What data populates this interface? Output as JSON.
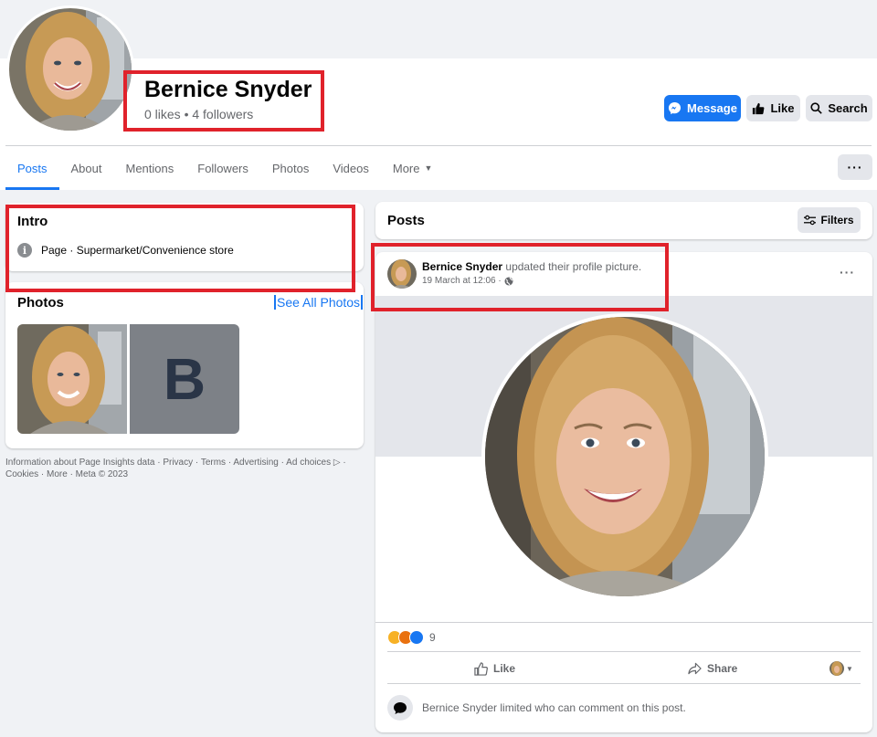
{
  "page": {
    "name": "Bernice Snyder",
    "stats": "0 likes • 4 followers"
  },
  "header_buttons": {
    "message": "Message",
    "like": "Like",
    "search": "Search"
  },
  "tabs": [
    {
      "label": "Posts",
      "active": true
    },
    {
      "label": "About"
    },
    {
      "label": "Mentions"
    },
    {
      "label": "Followers"
    },
    {
      "label": "Photos"
    },
    {
      "label": "Videos"
    },
    {
      "label": "More"
    }
  ],
  "more_actions": "···",
  "intro": {
    "title": "Intro",
    "category": "Page · Supermarket/Convenience store"
  },
  "photos": {
    "title": "Photos",
    "see_all": "See All Photos",
    "placeholder_letter": "B"
  },
  "footer": "Information about Page Insights data · Privacy · Terms · Advertising · Ad choices ▷ · Cookies · More · Meta © 2023",
  "posts": {
    "title": "Posts",
    "filters": "Filters"
  },
  "post": {
    "author": "Bernice Snyder",
    "action": "updated their profile picture.",
    "time": "19 March at 12:06 ·",
    "options": "···",
    "reaction_count": "9",
    "like": "Like",
    "share": "Share",
    "limited_notice": "Bernice Snyder limited who can comment on this post."
  },
  "colors": {
    "accent": "#1877f2",
    "highlight": "#e0222b",
    "background": "#f0f2f5"
  }
}
